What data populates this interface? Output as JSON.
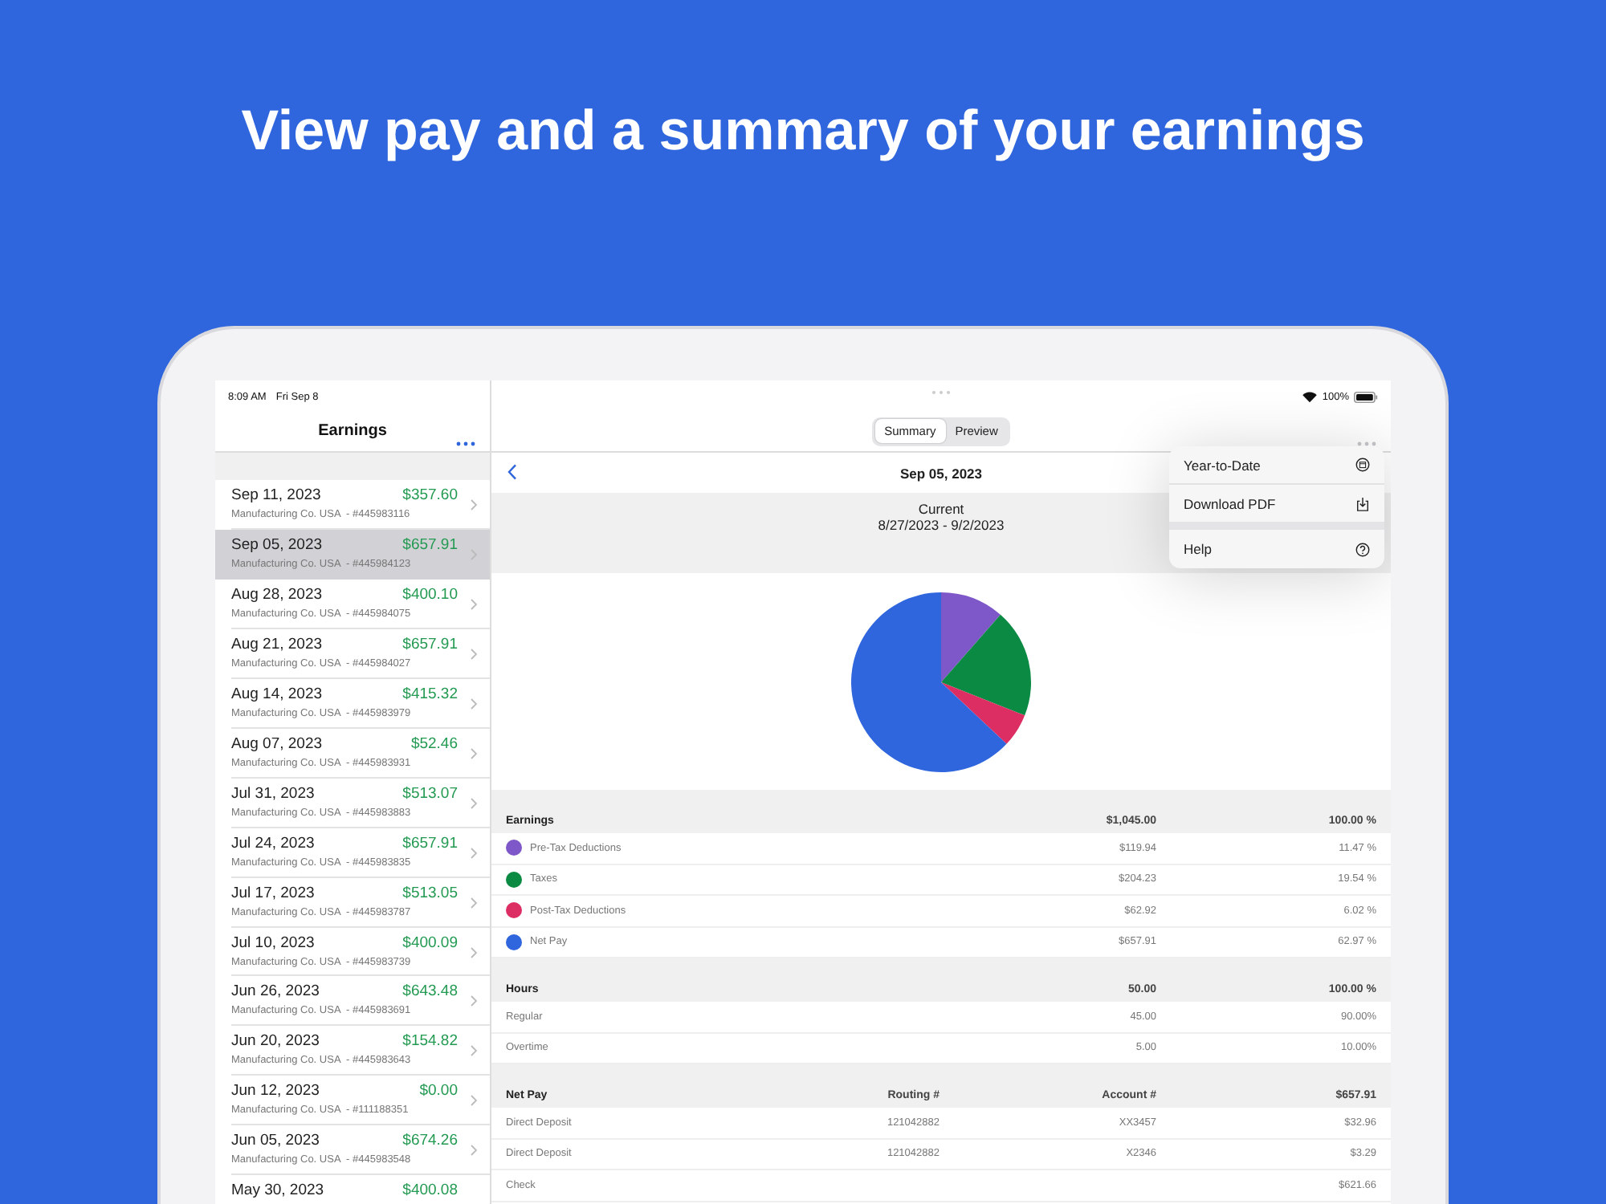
{
  "headline": "View pay and a summary of your earnings",
  "status_bar": {
    "time": "8:09 AM",
    "date": "Fri Sep 8",
    "battery": "100%"
  },
  "sidebar": {
    "title": "Earnings",
    "items": [
      {
        "date": "Sep 11, 2023",
        "amount": "$357.60",
        "detail": "Manufacturing Co. USA  - #445983116",
        "selected": false
      },
      {
        "date": "Sep 05, 2023",
        "amount": "$657.91",
        "detail": "Manufacturing Co. USA  - #445984123",
        "selected": true
      },
      {
        "date": "Aug 28, 2023",
        "amount": "$400.10",
        "detail": "Manufacturing Co. USA  - #445984075",
        "selected": false
      },
      {
        "date": "Aug 21, 2023",
        "amount": "$657.91",
        "detail": "Manufacturing Co. USA  - #445984027",
        "selected": false
      },
      {
        "date": "Aug 14, 2023",
        "amount": "$415.32",
        "detail": "Manufacturing Co. USA  - #445983979",
        "selected": false
      },
      {
        "date": "Aug 07, 2023",
        "amount": "$52.46",
        "detail": "Manufacturing Co. USA  - #445983931",
        "selected": false
      },
      {
        "date": "Jul 31, 2023",
        "amount": "$513.07",
        "detail": "Manufacturing Co. USA  - #445983883",
        "selected": false
      },
      {
        "date": "Jul 24, 2023",
        "amount": "$657.91",
        "detail": "Manufacturing Co. USA  - #445983835",
        "selected": false
      },
      {
        "date": "Jul 17, 2023",
        "amount": "$513.05",
        "detail": "Manufacturing Co. USA  - #445983787",
        "selected": false
      },
      {
        "date": "Jul 10, 2023",
        "amount": "$400.09",
        "detail": "Manufacturing Co. USA  - #445983739",
        "selected": false
      },
      {
        "date": "Jun 26, 2023",
        "amount": "$643.48",
        "detail": "Manufacturing Co. USA  - #445983691",
        "selected": false
      },
      {
        "date": "Jun 20, 2023",
        "amount": "$154.82",
        "detail": "Manufacturing Co. USA  - #445983643",
        "selected": false
      },
      {
        "date": "Jun 12, 2023",
        "amount": "$0.00",
        "detail": "Manufacturing Co. USA  - #111188351",
        "selected": false
      },
      {
        "date": "Jun 05, 2023",
        "amount": "$674.26",
        "detail": "Manufacturing Co. USA  - #445983548",
        "selected": false
      },
      {
        "date": "May 30, 2023",
        "amount": "$400.08",
        "selected": false
      }
    ]
  },
  "detail": {
    "tabs": [
      {
        "label": "Summary",
        "selected": true
      },
      {
        "label": "Preview",
        "selected": false
      }
    ],
    "date": "Sep 05, 2023",
    "period_label": "Current",
    "period": "8/27/2023 - 9/2/2023",
    "chart_data": {
      "type": "pie",
      "values": [
        11.47,
        19.54,
        6.02,
        62.97
      ]
    },
    "earnings": {
      "header": {
        "label": "Earnings",
        "amount": "$1,045.00",
        "percent": "100.00 %"
      },
      "rows": [
        {
          "label": "Pre-Tax Deductions",
          "amount": "$119.94",
          "percent": "11.47 %",
          "color": "#7e57c8"
        },
        {
          "label": "Taxes",
          "amount": "$204.23",
          "percent": "19.54 %",
          "color": "#0b8a43"
        },
        {
          "label": "Post-Tax Deductions",
          "amount": "$62.92",
          "percent": "6.02 %",
          "color": "#dd2e64"
        },
        {
          "label": "Net Pay",
          "amount": "$657.91",
          "percent": "62.97 %",
          "color": "#2f66dd"
        }
      ]
    },
    "hours": {
      "header": {
        "label": "Hours",
        "amount": "50.00",
        "percent": "100.00 %"
      },
      "rows": [
        {
          "label": "Regular",
          "amount": "45.00",
          "percent": "90.00%"
        },
        {
          "label": "Overtime",
          "amount": "5.00",
          "percent": "10.00%"
        }
      ]
    },
    "net_pay": {
      "columns": [
        "Net Pay",
        "Routing #",
        "Account #",
        "$657.91"
      ],
      "rows": [
        [
          "Direct Deposit",
          "121042882",
          "XX3457",
          "$32.96"
        ],
        [
          "Direct Deposit",
          "121042882",
          "X2346",
          "$3.29"
        ],
        [
          "Check",
          "",
          "",
          "$621.66"
        ]
      ]
    }
  },
  "menu": {
    "items": [
      {
        "label": "Year-to-Date",
        "kind": "calendar"
      },
      {
        "label": "Download PDF",
        "kind": "download"
      },
      {
        "label": "Help",
        "kind": "help"
      }
    ]
  }
}
